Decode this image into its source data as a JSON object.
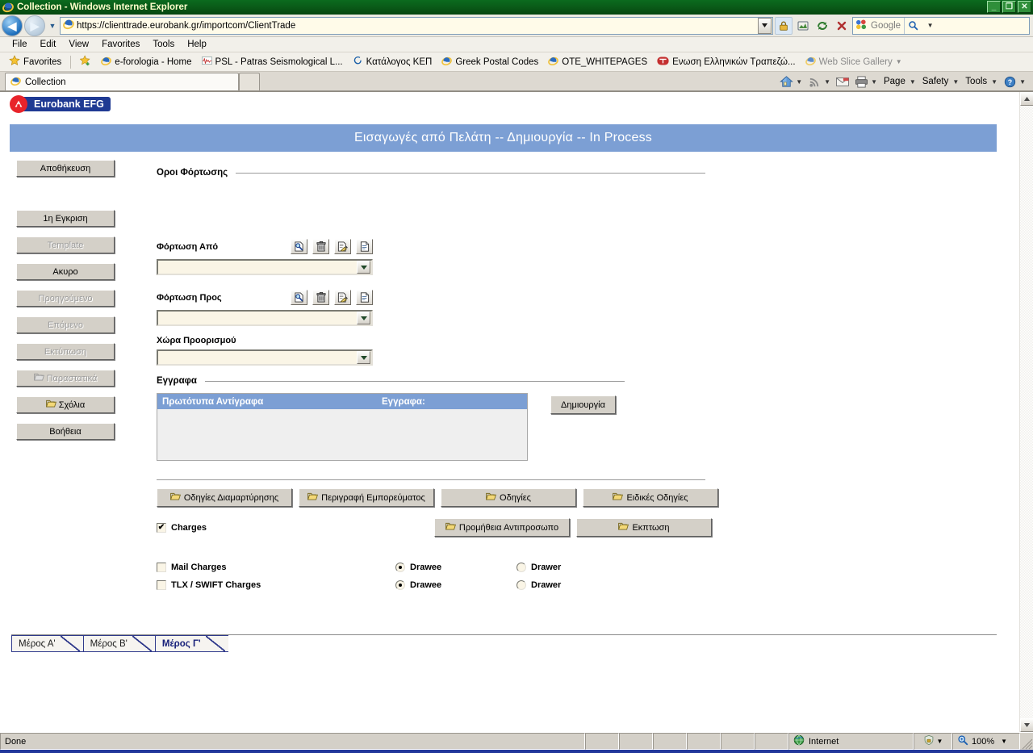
{
  "window": {
    "title": "Collection - Windows Internet Explorer",
    "minimize_label": "_",
    "restore_label": "❐",
    "close_label": "✕"
  },
  "browser": {
    "back_label": "◀",
    "forward_label": "▶",
    "history_caret": "▼",
    "url_protocol": "https://",
    "url_host": "clienttrade.eurobank.gr",
    "url_path": "/importcom/ClientTrade",
    "url_full": "https://clienttrade.eurobank.gr/importcom/ClientTrade",
    "url_dropdown_caret": "▼",
    "icons": {
      "lock": "lock-icon",
      "compatibility": "compatibility-view-icon",
      "refresh": "refresh-icon",
      "stop": "stop-icon",
      "search": "search-icon"
    },
    "search_placeholder": "Google",
    "search_caret": "▼",
    "menu": [
      {
        "label": "File",
        "accel": "F"
      },
      {
        "label": "Edit",
        "accel": "E"
      },
      {
        "label": "View",
        "accel": "V"
      },
      {
        "label": "Favorites",
        "accel": "a"
      },
      {
        "label": "Tools",
        "accel": "T"
      },
      {
        "label": "Help",
        "accel": "H"
      }
    ],
    "favorites_button": "Favorites",
    "favorites": [
      {
        "label": "e-forologia - Home",
        "icon": "ie-page-icon",
        "dim": false
      },
      {
        "label": "PSL - Patras Seismological L...",
        "icon": "psl-icon",
        "dim": false
      },
      {
        "label": "Κατάλογος ΚΕΠ",
        "icon": "kep-icon",
        "dim": false
      },
      {
        "label": "Greek Postal Codes",
        "icon": "ie-page-icon",
        "dim": false
      },
      {
        "label": "OTE_WHITEPAGES",
        "icon": "ie-page-icon",
        "dim": false
      },
      {
        "label": "Ενωση Ελληνικών Τραπεζώ...",
        "icon": "bank-union-icon",
        "dim": false
      },
      {
        "label": "Web Slice Gallery",
        "icon": "ie-page-icon",
        "dim": true
      }
    ],
    "webslice_caret": "▼",
    "tabs": [
      {
        "label": "Collection",
        "icon": "ie-page-icon",
        "active": true
      }
    ],
    "new_tab_label": "",
    "command_bar": [
      {
        "label": "",
        "name": "home-icon",
        "caret": "▼"
      },
      {
        "label": "",
        "name": "feeds-icon",
        "caret": "▼"
      },
      {
        "label": "",
        "name": "mail-icon",
        "caret": ""
      },
      {
        "label": "",
        "name": "print-icon",
        "caret": "▼"
      },
      {
        "label": "Page",
        "name": "page-menu",
        "caret": "▼"
      },
      {
        "label": "Safety",
        "name": "safety-menu",
        "caret": "▼"
      },
      {
        "label": "Tools",
        "name": "tools-menu",
        "caret": "▼"
      },
      {
        "label": "",
        "name": "help-icon",
        "caret": "▼"
      }
    ]
  },
  "app": {
    "brand": "Eurobank EFG",
    "banner_title": "Εισαγωγές από Πελάτη -- Δημιουργία -- In Process",
    "banner_color": "#7c9fd4",
    "brand_badge_color": "#1f3a93",
    "brand_mark_color": "#e8232a"
  },
  "sidebar": {
    "buttons": [
      {
        "label": "Αποθήκευση",
        "disabled": false,
        "icon": ""
      },
      {
        "label": "1η Εγκριση",
        "disabled": false,
        "icon": ""
      },
      {
        "label": "Template",
        "disabled": true,
        "icon": ""
      },
      {
        "label": "Ακυρο",
        "disabled": false,
        "icon": ""
      },
      {
        "label": "Προηγούμενο",
        "disabled": true,
        "icon": ""
      },
      {
        "label": "Επόμενο",
        "disabled": true,
        "icon": ""
      },
      {
        "label": "Εκτύπωση",
        "disabled": true,
        "icon": ""
      },
      {
        "label": "Παραστατικά",
        "disabled": true,
        "icon": "folder-icon"
      },
      {
        "label": "Σχόλια",
        "disabled": false,
        "icon": "folder-icon"
      },
      {
        "label": "Βοήθεια",
        "disabled": false,
        "icon": ""
      }
    ]
  },
  "form": {
    "section_shipping": "Οροι Φόρτωσης",
    "fields": [
      {
        "label": "Φόρτωση Από",
        "value": "",
        "has_icons": true,
        "icons": [
          "search-icon",
          "trash-icon",
          "edit-document-icon",
          "document-icon"
        ],
        "caret": "▼"
      },
      {
        "label": "Φόρτωση Προς",
        "value": "",
        "has_icons": true,
        "icons": [
          "search-icon",
          "trash-icon",
          "edit-document-icon",
          "document-icon"
        ],
        "caret": "▼"
      },
      {
        "label": "Χώρα Προορισμού",
        "value": "",
        "has_icons": false,
        "icons": [],
        "caret": "▼"
      }
    ],
    "section_documents": "Εγγραφα",
    "documents_grid": {
      "columns": [
        "Πρωτότυπα  Αντίγραφα",
        "Εγγραφα:"
      ],
      "rows": []
    },
    "create_button": "Δημιουργία",
    "action_buttons_row1": [
      {
        "label": "Οδηγίες Διαμαρτύρησης",
        "icon": "folder-icon"
      },
      {
        "label": "Περιγραφή Εμπορεύματος",
        "icon": "folder-icon"
      },
      {
        "label": "Οδηγίες",
        "icon": "folder-icon"
      },
      {
        "label": "Ειδικές Οδηγίες",
        "icon": "folder-icon"
      }
    ],
    "action_buttons_row2": [
      {
        "label": "Προμήθεια Αντιπροσωπο",
        "icon": "folder-icon"
      },
      {
        "label": "Εκπτωση",
        "icon": "folder-icon"
      }
    ],
    "charges_checkbox": {
      "label": "Charges",
      "checked": true
    },
    "charge_rows": [
      {
        "label": "Mail Charges",
        "checked": false,
        "options": [
          {
            "label": "Drawee",
            "selected": true
          },
          {
            "label": "Drawer",
            "selected": false
          }
        ]
      },
      {
        "label": "TLX / SWIFT Charges",
        "checked": false,
        "options": [
          {
            "label": "Drawee",
            "selected": true
          },
          {
            "label": "Drawer",
            "selected": false
          }
        ]
      }
    ]
  },
  "page_tabs": [
    {
      "label": "Μέρος Α'",
      "active": false
    },
    {
      "label": "Μέρος Β'",
      "active": false
    },
    {
      "label": "Μέρος Γ'",
      "active": true
    }
  ],
  "statusbar": {
    "message": "Done",
    "zone": "Internet",
    "zone_icon": "globe-icon",
    "security_icon": "protected-mode-icon",
    "security_caret": "▼",
    "zoom_icon": "zoom-icon",
    "zoom_level": "100%",
    "zoom_caret": "▼"
  }
}
